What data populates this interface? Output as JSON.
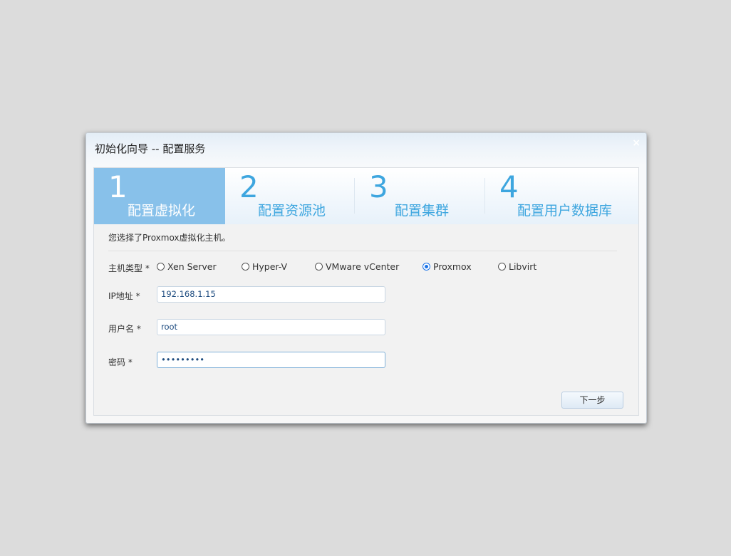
{
  "dialog": {
    "title": "初始化向导 -- 配置服务",
    "close_label": "×"
  },
  "steps": [
    {
      "num": "1",
      "label": "配置虚拟化",
      "active": true
    },
    {
      "num": "2",
      "label": "配置资源池",
      "active": false
    },
    {
      "num": "3",
      "label": "配置集群",
      "active": false
    },
    {
      "num": "4",
      "label": "配置用户数据库",
      "active": false
    }
  ],
  "form": {
    "info": "您选择了Proxmox虚拟化主机。",
    "host_type": {
      "label": "主机类型 *",
      "options": [
        "Xen Server",
        "Hyper-V",
        "VMware vCenter",
        "Proxmox",
        "Libvirt"
      ],
      "selected": "Proxmox"
    },
    "ip": {
      "label": "IP地址 *",
      "value": "192.168.1.15"
    },
    "username": {
      "label": "用户名 *",
      "value": "root"
    },
    "password": {
      "label": "密码 *",
      "value": "•••••••••"
    }
  },
  "buttons": {
    "next": "下一步"
  },
  "colors": {
    "accent": "#3ea6df",
    "active_step_bg": "#88c1ea",
    "backdrop": "#dcdcdc"
  }
}
